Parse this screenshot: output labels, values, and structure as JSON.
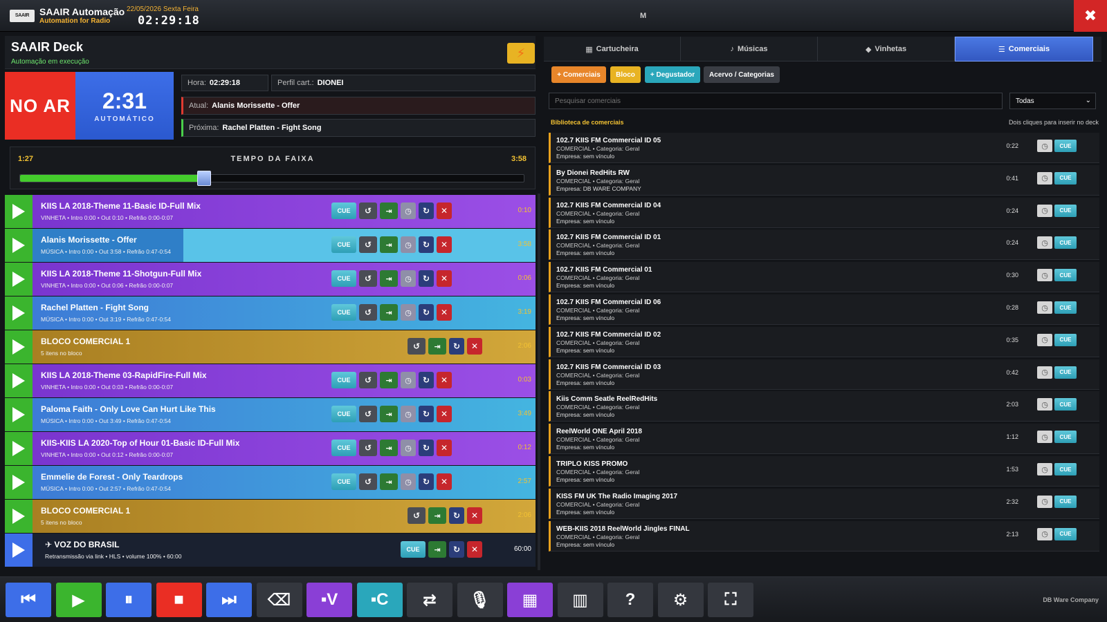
{
  "header": {
    "logo_text": "SAAIR",
    "app_name": "SAAIR Automação",
    "app_subtitle": "Automation for Radio",
    "date": "22/05/2026 Sexta Feira",
    "clock": "02:29:18",
    "center_label": "M",
    "close_label": "✖"
  },
  "deck": {
    "title": "SAAIR Deck",
    "status": "Automação em execução",
    "on_air": "NO AR",
    "countdown": "2:31",
    "mode": "AUTOMÁTICO",
    "hora_label": "Hora:",
    "hora": "02:29:18",
    "perfil_label": "Perfil cart.:",
    "perfil": "DIONEI",
    "atual_label": "Atual:",
    "atual": "Alanis Morissette - Offer",
    "proxima_label": "Próxima:",
    "proxima": "Rachel Platten - Fight Song",
    "elapsed": "1:27",
    "progress_title": "TEMPO DA FAIXA",
    "total": "3:58",
    "progress_fraction": 0.365
  },
  "queue": [
    {
      "type": "vinheta",
      "title": "KIIS LA 2018-Theme 11-Basic ID-Full Mix",
      "meta": "VINHETA • Intro 0:00 • Out 0:10 • Refrão 0:00-0:07",
      "duration": "0:10"
    },
    {
      "type": "musica",
      "title": "Alanis Morissette - Offer",
      "meta": "MÚSICA • Intro 0:00 • Out 3:58 • Refrão 0:47-0:54",
      "duration": "3:58"
    },
    {
      "type": "vinheta",
      "title": "KIIS LA 2018-Theme 11-Shotgun-Full Mix",
      "meta": "VINHETA • Intro 0:00 • Out 0:06 • Refrão 0:00-0:07",
      "duration": "0:06"
    },
    {
      "type": "musica",
      "title": "Rachel Platten - Fight Song",
      "meta": "MÚSICA • Intro 0:00 • Out 3:19 • Refrão 0:47-0:54",
      "duration": "3:19"
    },
    {
      "type": "bloco",
      "title": "BLOCO COMERCIAL 1",
      "meta": "5 itens no bloco",
      "duration": "2:06"
    },
    {
      "type": "vinheta",
      "title": "KIIS LA 2018-Theme 03-RapidFire-Full Mix",
      "meta": "VINHETA • Intro 0:00 • Out 0:03 • Refrão 0:00-0:07",
      "duration": "0:03"
    },
    {
      "type": "musica",
      "title": "Paloma Faith - Only Love Can Hurt Like This",
      "meta": "MÚSICA • Intro 0:00 • Out 3:49 • Refrão 0:47-0:54",
      "duration": "3:49"
    },
    {
      "type": "vinheta",
      "title": "KIIS-KIIS LA 2020-Top of Hour 01-Basic ID-Full Mix",
      "meta": "VINHETA • Intro 0:00 • Out 0:12 • Refrão 0:00-0:07",
      "duration": "0:12"
    },
    {
      "type": "musica",
      "title": "Emmelie de Forest - Only Teardrops",
      "meta": "MÚSICA • Intro 0:00 • Out 2:57 • Refrão 0:47-0:54",
      "duration": "2:57"
    },
    {
      "type": "bloco",
      "title": "BLOCO COMERCIAL 1",
      "meta": "5 itens no bloco",
      "duration": "2:06"
    },
    {
      "type": "link",
      "title": "VOZ DO BRASIL",
      "meta": "Retransmissão via link • HLS • volume 100% • 60:00",
      "duration": "60:00"
    }
  ],
  "cue_label": "CUE",
  "tabs": [
    "Cartucheira",
    "Músicas",
    "Vinhetas",
    "Comerciais"
  ],
  "tab_icons": [
    "▦",
    "♪",
    "◆",
    "☰"
  ],
  "actions": {
    "add_comerciais": "+ Comerciais",
    "bloco": "Bloco",
    "degustador": "+ Degustador",
    "acervo": "Acervo / Categorias"
  },
  "search": {
    "placeholder": "Pesquisar comerciais",
    "filter": "Todas"
  },
  "library": {
    "heading": "Biblioteca de comerciais",
    "hint": "Dois cliques para inserir no deck",
    "items": [
      {
        "title": "102.7 KIIS FM Commercial ID 05",
        "meta": "COMERCIAL • Categoria: Geral",
        "empresa": "Empresa: sem vínculo",
        "duration": "0:22"
      },
      {
        "title": "By Dionei RedHits RW",
        "meta": "COMERCIAL • Categoria: Geral",
        "empresa": "Empresa: DB WARE COMPANY",
        "duration": "0:41"
      },
      {
        "title": "102.7 KIIS FM Commercial ID 04",
        "meta": "COMERCIAL • Categoria: Geral",
        "empresa": "Empresa: sem vínculo",
        "duration": "0:24"
      },
      {
        "title": "102.7 KIIS FM Commercial ID 01",
        "meta": "COMERCIAL • Categoria: Geral",
        "empresa": "Empresa: sem vínculo",
        "duration": "0:24"
      },
      {
        "title": "102.7 KIIS FM Commercial 01",
        "meta": "COMERCIAL • Categoria: Geral",
        "empresa": "Empresa: sem vínculo",
        "duration": "0:30"
      },
      {
        "title": "102.7 KIIS FM Commercial ID 06",
        "meta": "COMERCIAL • Categoria: Geral",
        "empresa": "Empresa: sem vínculo",
        "duration": "0:28"
      },
      {
        "title": "102.7 KIIS FM Commercial ID 02",
        "meta": "COMERCIAL • Categoria: Geral",
        "empresa": "Empresa: sem vínculo",
        "duration": "0:35"
      },
      {
        "title": "102.7 KIIS FM Commercial ID 03",
        "meta": "COMERCIAL • Categoria: Geral",
        "empresa": "Empresa: sem vínculo",
        "duration": "0:42"
      },
      {
        "title": "Kiis Comm Seatle ReelRedHits",
        "meta": "COMERCIAL • Categoria: Geral",
        "empresa": "Empresa: sem vínculo",
        "duration": "2:03"
      },
      {
        "title": "ReelWorld ONE April 2018",
        "meta": "COMERCIAL • Categoria: Geral",
        "empresa": "Empresa: sem vínculo",
        "duration": "1:12"
      },
      {
        "title": "TRIPLO KISS PROMO",
        "meta": "COMERCIAL • Categoria: Geral",
        "empresa": "Empresa: sem vínculo",
        "duration": "1:53"
      },
      {
        "title": "KISS FM UK The Radio Imaging 2017",
        "meta": "COMERCIAL • Categoria: Geral",
        "empresa": "Empresa: sem vínculo",
        "duration": "2:32"
      },
      {
        "title": "WEB-KIIS 2018 ReelWorld Jingles FINAL",
        "meta": "COMERCIAL • Categoria: Geral",
        "empresa": "Empresa: sem vínculo",
        "duration": "2:13"
      }
    ]
  },
  "toolbar": [
    {
      "name": "previous",
      "glyph": "⏮",
      "color": "#3d6ee8"
    },
    {
      "name": "play",
      "glyph": "▶",
      "color": "#3bb52e"
    },
    {
      "name": "pause",
      "glyph": "⏸",
      "color": "#3d6ee8"
    },
    {
      "name": "stop",
      "glyph": "■",
      "color": "#ea2e24"
    },
    {
      "name": "next",
      "glyph": "⏭",
      "color": "#3d6ee8"
    },
    {
      "name": "eraser",
      "glyph": "⌫",
      "color": "#34373e"
    },
    {
      "name": "vinhetas",
      "glyph": "▪V",
      "color": "#8a3fd6"
    },
    {
      "name": "comerciais",
      "glyph": "▪C",
      "color": "#2aa7bb"
    },
    {
      "name": "shuffle",
      "glyph": "⇄",
      "color": "#34373e"
    },
    {
      "name": "microphone",
      "glyph": "🎙",
      "color": "#34373e"
    },
    {
      "name": "grid",
      "glyph": "▦",
      "color": "#8a3fd6"
    },
    {
      "name": "building",
      "glyph": "▥",
      "color": "#34373e"
    },
    {
      "name": "help",
      "glyph": "?",
      "color": "#34373e"
    },
    {
      "name": "settings",
      "glyph": "⚙",
      "color": "#34373e"
    },
    {
      "name": "fullscreen",
      "glyph": "⛶",
      "color": "#34373e"
    }
  ],
  "company": "DB Ware Company",
  "colors": {
    "vinheta": "#8a3fd6",
    "musica": "#3aa0d8",
    "bloco": "#c69a2b",
    "link": "#1f2a3c",
    "accent": "#3d6ee8"
  }
}
